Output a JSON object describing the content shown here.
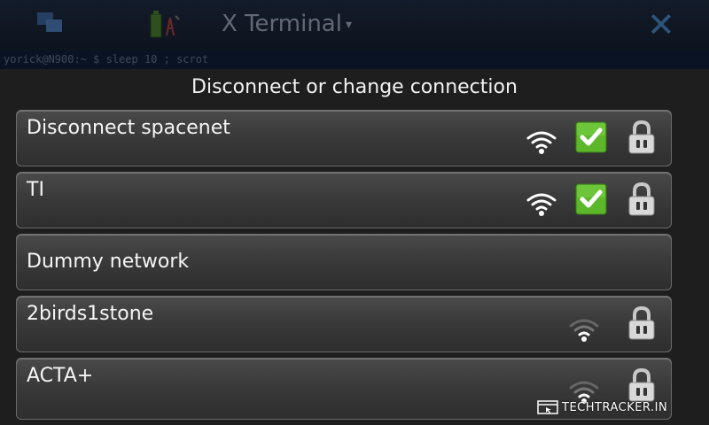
{
  "background_app": {
    "title": "X Terminal",
    "title_arrow": "▾",
    "close_glyph": "✕",
    "terminal_line": "yorick@N900:~ $ sleep 10 ; scrot"
  },
  "dialog": {
    "title": "Disconnect or change connection",
    "networks": [
      {
        "label": "Disconnect spacenet",
        "signal": "strong",
        "connected": true,
        "locked": true
      },
      {
        "label": "TI",
        "signal": "strong",
        "connected": true,
        "locked": true
      },
      {
        "label": "Dummy network",
        "signal": "none",
        "connected": false,
        "locked": false
      },
      {
        "label": "2birds1stone",
        "signal": "weak",
        "connected": false,
        "locked": true
      },
      {
        "label": "ACTA+",
        "signal": "weak",
        "connected": false,
        "locked": true
      }
    ]
  },
  "watermark": {
    "text": "TECHTRACKER.IN"
  },
  "icons": {
    "wifi_strong": "wifi-strong-icon",
    "wifi_weak": "wifi-weak-icon",
    "check": "checkmark-icon",
    "lock": "lock-icon"
  },
  "colors": {
    "check_green": "#5cb82a",
    "dialog_bg": "#1e1e1e",
    "row_border": "#6b6b6b",
    "close_blue": "#4a90d9"
  }
}
